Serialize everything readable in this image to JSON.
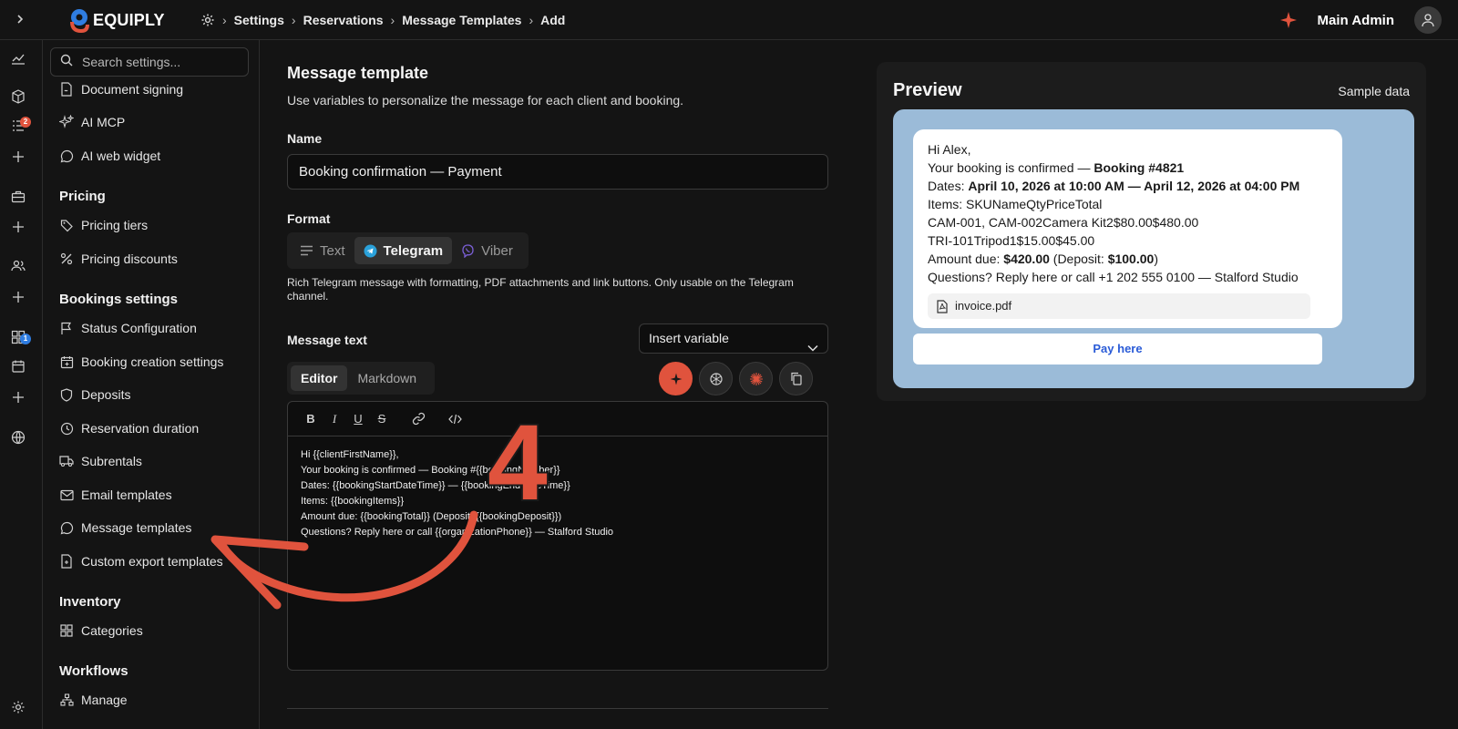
{
  "app": {
    "brand": "EQUIPLY"
  },
  "breadcrumb": [
    "Settings",
    "Reservations",
    "Message Templates",
    "Add"
  ],
  "user": {
    "name": "Main Admin"
  },
  "rail_badges": {
    "bookings": "2",
    "calendar": "1"
  },
  "sidebar": {
    "search_placeholder": "Search settings...",
    "items_top": [
      "Document signing",
      "AI MCP",
      "AI web widget"
    ],
    "pricing": {
      "heading": "Pricing",
      "items": [
        "Pricing tiers",
        "Pricing discounts"
      ]
    },
    "bookings": {
      "heading": "Bookings settings",
      "items": [
        "Status Configuration",
        "Booking creation settings",
        "Deposits",
        "Reservation duration",
        "Subrentals",
        "Email templates",
        "Message templates",
        "Custom export templates"
      ]
    },
    "inventory": {
      "heading": "Inventory",
      "items": [
        "Categories"
      ]
    },
    "workflows": {
      "heading": "Workflows",
      "items": [
        "Manage"
      ]
    }
  },
  "form": {
    "title": "Message template",
    "subtitle": "Use variables to personalize the message for each client and booking.",
    "name_label": "Name",
    "name_value": "Booking confirmation — Payment",
    "format_label": "Format",
    "formats": [
      "Text",
      "Telegram",
      "Viber"
    ],
    "format_selected": "Telegram",
    "format_help": "Rich Telegram message with formatting, PDF attachments and link buttons. Only usable on the Telegram channel.",
    "message_label": "Message text",
    "insert_variable": "Insert variable",
    "editor_tabs": [
      "Editor",
      "Markdown"
    ],
    "editor_lines": [
      "Hi {{clientFirstName}},",
      "Your booking is confirmed — Booking #{{bookingNumber}}",
      "Dates: {{bookingStartDateTime}} — {{bookingEndDateTime}}",
      "Items: {{bookingItems}}",
      "Amount due: {{bookingTotal}} (Deposit: {{bookingDeposit}})",
      "Questions? Reply here or call {{organizationPhone}} — Stalford Studio"
    ]
  },
  "preview": {
    "title": "Preview",
    "sample_label": "Sample data",
    "greeting": "Hi Alex,",
    "line_confirm_prefix": "Your booking is confirmed — ",
    "line_confirm_bold": "Booking #4821",
    "line_dates_prefix": "Dates: ",
    "line_dates_bold": "April 10, 2026 at 10:00 AM — April 12, 2026 at 04:00 PM",
    "line_items": "Items: SKUNameQtyPriceTotal",
    "line_item1": "CAM-001, CAM-002Camera Kit2$80.00$480.00",
    "line_item2": "TRI-101Tripod1$15.00$45.00",
    "line_amount_prefix": "Amount due: ",
    "line_amount_bold": "$420.00",
    "line_deposit_prefix": " (Deposit: ",
    "line_deposit_bold": "$100.00",
    "line_deposit_suffix": ")",
    "line_questions": "Questions? Reply here or call +1 202 555 0100 — Stalford Studio",
    "attachment": "invoice.pdf",
    "button": "Pay here"
  },
  "annotation": {
    "step_number": "4"
  },
  "colors": {
    "accent": "#e0533d",
    "chat_bg": "#9bbbd8",
    "link": "#2a5bd7"
  }
}
